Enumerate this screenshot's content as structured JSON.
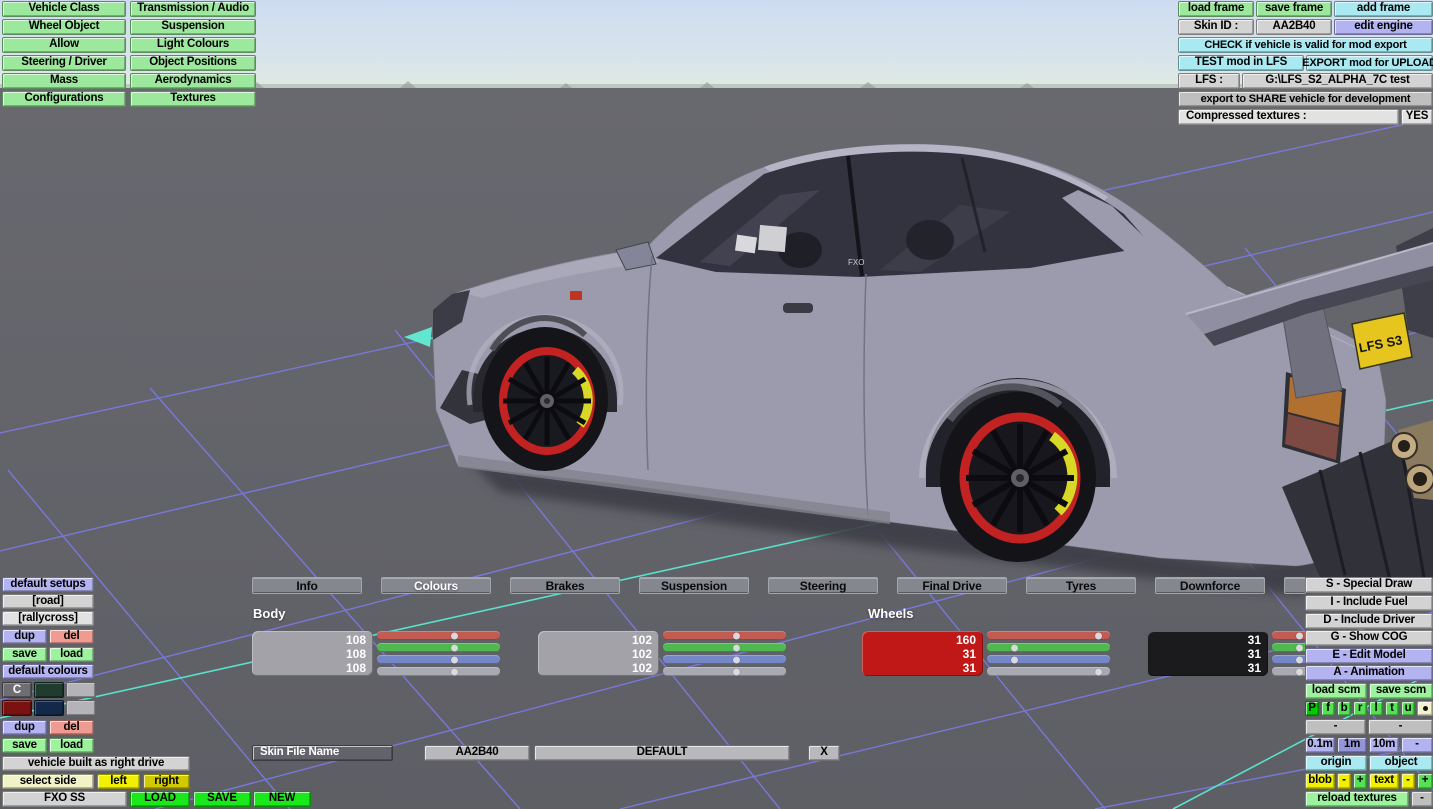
{
  "menu": {
    "items": [
      "Vehicle Class",
      "Transmission / Audio",
      "Wheel Object",
      "Suspension",
      "Allow",
      "Light Colours",
      "Steering / Driver",
      "Object Positions",
      "Mass",
      "Aerodynamics",
      "Configurations",
      "Textures"
    ]
  },
  "frame_bar": {
    "load_frame": "load frame",
    "save_frame": "save frame",
    "add_frame": "add frame",
    "skin_id_label": "Skin ID :",
    "skin_id_value": "AA2B40",
    "edit_engine": "edit engine",
    "check_export": "CHECK if vehicle is valid for mod export",
    "test_mod": "TEST mod in LFS",
    "export_mod": "EXPORT mod for UPLOAD",
    "lfs_label": "LFS :",
    "lfs_path": "G:\\LFS_S2_ALPHA_7C test",
    "share": "export to SHARE vehicle for development",
    "compressed_label": "Compressed textures :",
    "compressed_value": "YES"
  },
  "tabs": {
    "items": [
      "Info",
      "Colours",
      "Brakes",
      "Suspension",
      "Steering",
      "Final Drive",
      "Tyres",
      "Downforce"
    ],
    "selected": "Colours"
  },
  "colours": {
    "body_label": "Body",
    "wheels_label": "Wheels",
    "slider_max": 170,
    "blocks": [
      {
        "name": "body-colour-1",
        "color": "#a2a2a8",
        "values": [
          108,
          108,
          108
        ]
      },
      {
        "name": "body-colour-2",
        "color": "#a2a2a8",
        "values": [
          102,
          102,
          102
        ]
      },
      {
        "name": "wheel-rim-colour",
        "color": "#c01717",
        "values": [
          160,
          31,
          31
        ]
      },
      {
        "name": "wheel-tyre-colour",
        "color": "#1b1b1e",
        "values": [
          31,
          31,
          31
        ]
      }
    ]
  },
  "skin": {
    "label": "Skin File Name",
    "id": "AA2B40",
    "name": "DEFAULT",
    "clear": "X"
  },
  "setups": {
    "header": "default setups",
    "preset_road": "[road]",
    "preset_rallycross": "[rallycross]",
    "dup": "dup",
    "del": "del",
    "save": "save",
    "load": "load"
  },
  "default_colours": {
    "header": "default colours",
    "c_label": "C",
    "swatches": [
      "#6e6e74",
      "#1e3d2e",
      "#b4b4b8",
      "#7a1212",
      "#12294a",
      "#b4b4b8"
    ],
    "dup": "dup",
    "del": "del",
    "save": "save",
    "load": "load"
  },
  "drive": {
    "built": "vehicle built as right drive",
    "select_side": "select side",
    "left": "left",
    "right": "right"
  },
  "file_bar": {
    "model": "FXO SS",
    "load": "LOAD",
    "save": "SAVE",
    "new": "NEW"
  },
  "view_panel": {
    "special_draw": "S - Special Draw",
    "include_fuel": "I - Include Fuel",
    "include_driver": "D - Include Driver",
    "show_cog": "G - Show COG",
    "edit_model": "E - Edit Model",
    "animation": "A - Animation",
    "load_scm": "load scm",
    "save_scm": "save scm",
    "letters": [
      "P",
      "f",
      "b",
      "r",
      "l",
      "t",
      "u"
    ],
    "dash1": "-",
    "dash2": "-",
    "scale_01": "0.1m",
    "scale_1": "1m",
    "scale_10": "10m",
    "scale_dash": "-",
    "origin": "origin",
    "object": "object",
    "blob": "blob",
    "blob_minus": "-",
    "blob_plus": "+",
    "text": "text",
    "text_minus": "-",
    "text_plus": "+",
    "reload": "reload textures",
    "reload_dash": "-"
  },
  "viewport": {
    "plate_text": "LFS S3",
    "decal": "FXO"
  }
}
